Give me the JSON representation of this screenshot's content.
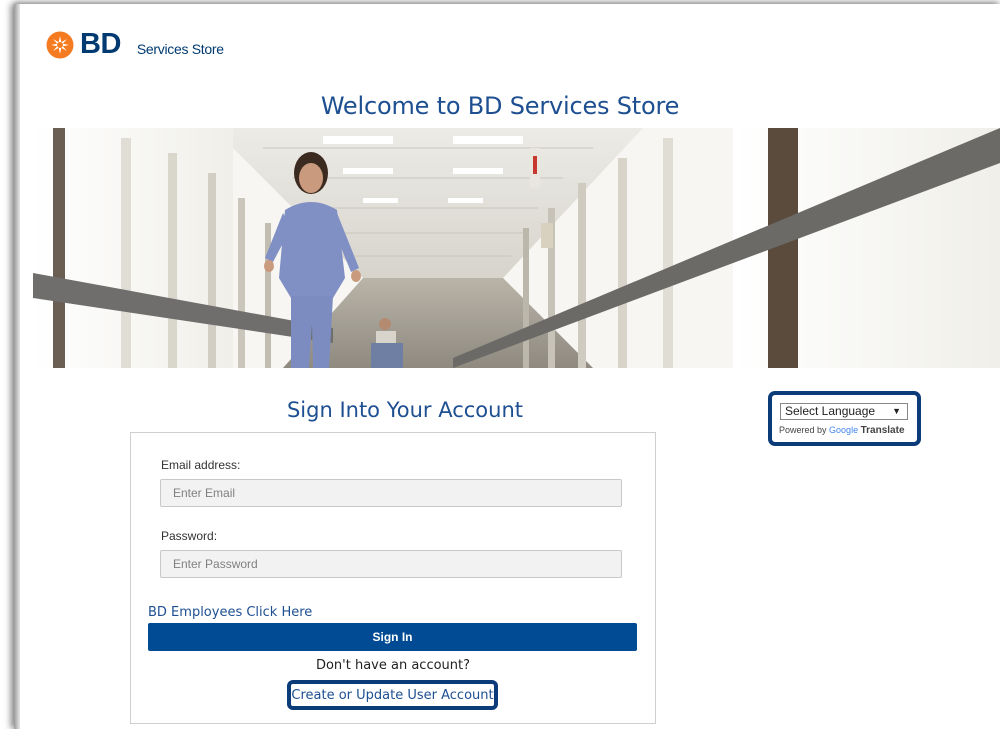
{
  "header": {
    "brand": "BD",
    "store_name": "Services Store"
  },
  "welcome_title": "Welcome to BD Services Store",
  "signin": {
    "title": "Sign Into Your Account",
    "email_label": "Email address:",
    "email_placeholder": "Enter Email",
    "email_value": "",
    "password_label": "Password:",
    "password_placeholder": "Enter Password",
    "password_value": "",
    "employees_link": "BD Employees Click Here",
    "signin_button": "Sign In",
    "no_account_text": "Don't have an account?",
    "create_link": "Create or Update User Account"
  },
  "translate": {
    "select_value": "Select Language",
    "powered_by": "Powered by",
    "google": "Google",
    "translate": "Translate"
  },
  "colors": {
    "brand_blue": "#003a70",
    "link_blue": "#1d4f91",
    "button_blue": "#004b93",
    "highlight_border": "#0b3b78",
    "logo_orange": "#f47b20"
  },
  "icons": {
    "logo": "bd-starburst-logo",
    "select_arrow": "triangle-down-icon"
  }
}
